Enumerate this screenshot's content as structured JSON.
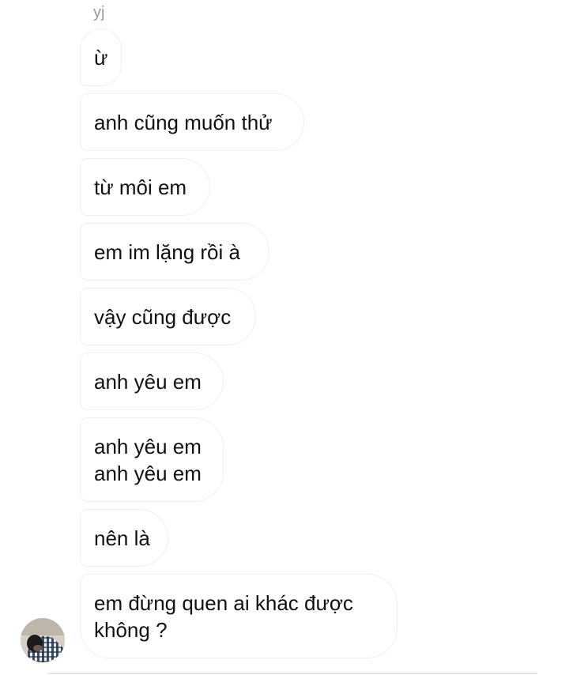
{
  "sender_name": "yj",
  "messages": [
    {
      "lines": [
        "ừ"
      ]
    },
    {
      "lines": [
        "anh cũng muốn thử"
      ]
    },
    {
      "lines": [
        "từ môi em"
      ]
    },
    {
      "lines": [
        "em im lặng rồi à"
      ]
    },
    {
      "lines": [
        "vậy cũng được"
      ]
    },
    {
      "lines": [
        "anh yêu em"
      ]
    },
    {
      "lines": [
        "anh yêu em",
        "anh yêu em"
      ]
    },
    {
      "lines": [
        "nên là"
      ]
    },
    {
      "lines": [
        "em đừng quen ai khác được",
        "không ?"
      ]
    }
  ],
  "colors": {
    "bubble_bg": "#ffffff",
    "bubble_border": "#efefef",
    "text": "#111111",
    "sender_name": "#9a9a9a"
  },
  "icons": {
    "avatar": "user-avatar-photo"
  }
}
